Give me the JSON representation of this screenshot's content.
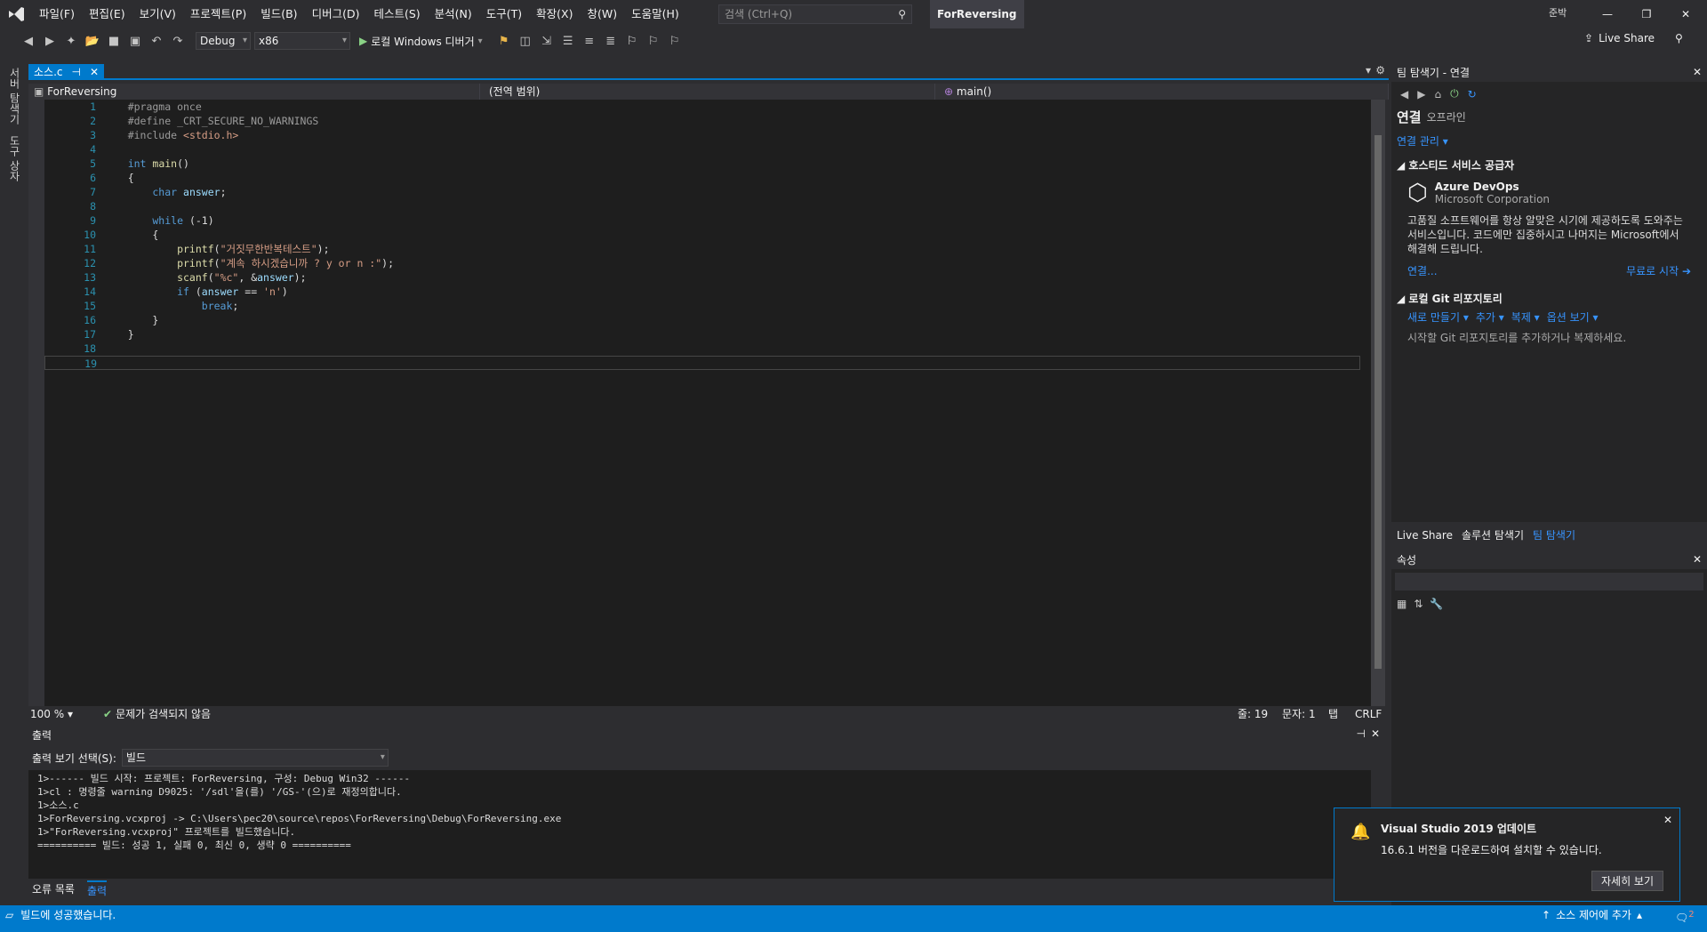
{
  "titlebar": {
    "menu": [
      "파일(F)",
      "편집(E)",
      "보기(V)",
      "프로젝트(P)",
      "빌드(B)",
      "디버그(D)",
      "테스트(S)",
      "분석(N)",
      "도구(T)",
      "확장(X)",
      "창(W)",
      "도움말(H)"
    ],
    "search_placeholder": "검색 (Ctrl+Q)",
    "solution_name": "ForReversing",
    "user_badge": "준박"
  },
  "toolbar": {
    "config": "Debug",
    "platform": "x86",
    "run_label": "로컬 Windows 디버거",
    "live_share": "Live Share"
  },
  "left_sidebar": {
    "items": [
      "서버 탐색기",
      "도구 상자"
    ]
  },
  "editor": {
    "tab_label": "소스.c",
    "nav_project": "ForReversing",
    "nav_scope": "(전역 범위)",
    "nav_function": "main()",
    "lines": [
      {
        "n": "1",
        "segs": [
          [
            "pp",
            "    #pragma once"
          ]
        ]
      },
      {
        "n": "2",
        "segs": [
          [
            "pp",
            "    #define _CRT_SECURE_NO_WARNINGS"
          ]
        ]
      },
      {
        "n": "3",
        "segs": [
          [
            "pp",
            "    #include "
          ],
          [
            "str",
            "<stdio.h>"
          ]
        ]
      },
      {
        "n": "4",
        "segs": []
      },
      {
        "n": "5",
        "segs": [
          [
            "kw",
            "    int"
          ],
          [
            "plain",
            " "
          ],
          [
            "fn",
            "main"
          ],
          [
            "plain",
            "()"
          ]
        ]
      },
      {
        "n": "6",
        "segs": [
          [
            "plain",
            "    {"
          ]
        ]
      },
      {
        "n": "7",
        "segs": [
          [
            "kw",
            "        char"
          ],
          [
            "plain",
            " "
          ],
          [
            "id",
            "answer"
          ],
          [
            "plain",
            ";"
          ]
        ]
      },
      {
        "n": "8",
        "segs": []
      },
      {
        "n": "9",
        "segs": [
          [
            "kw",
            "        while"
          ],
          [
            "plain",
            " (-1)"
          ]
        ]
      },
      {
        "n": "10",
        "segs": [
          [
            "plain",
            "        {"
          ]
        ]
      },
      {
        "n": "11",
        "segs": [
          [
            "fn",
            "            printf"
          ],
          [
            "plain",
            "("
          ],
          [
            "str",
            "\"거짓무한반복테스트\""
          ],
          [
            "plain",
            ");"
          ]
        ]
      },
      {
        "n": "12",
        "segs": [
          [
            "fn",
            "            printf"
          ],
          [
            "plain",
            "("
          ],
          [
            "str",
            "\"계속 하시겠습니까 ? y or n :\""
          ],
          [
            "plain",
            ");"
          ]
        ]
      },
      {
        "n": "13",
        "segs": [
          [
            "fn",
            "            scanf"
          ],
          [
            "plain",
            "("
          ],
          [
            "str",
            "\"%c\""
          ],
          [
            "plain",
            ", &"
          ],
          [
            "id",
            "answer"
          ],
          [
            "plain",
            ");"
          ]
        ]
      },
      {
        "n": "14",
        "segs": [
          [
            "kw",
            "            if"
          ],
          [
            "plain",
            " ("
          ],
          [
            "id",
            "answer"
          ],
          [
            "plain",
            " == "
          ],
          [
            "str",
            "'n'"
          ],
          [
            "plain",
            ")"
          ]
        ]
      },
      {
        "n": "15",
        "segs": [
          [
            "kw",
            "                break"
          ],
          [
            "plain",
            ";"
          ]
        ]
      },
      {
        "n": "16",
        "segs": [
          [
            "plain",
            "        }"
          ]
        ]
      },
      {
        "n": "17",
        "segs": [
          [
            "plain",
            "    }"
          ]
        ]
      },
      {
        "n": "18",
        "segs": []
      },
      {
        "n": "19",
        "segs": []
      }
    ],
    "zoom": "100 %",
    "issues": "문제가 검색되지 않음",
    "line_pos": "줄: 19",
    "col_pos": "문자: 1",
    "tab_mode": "탭",
    "eol": "CRLF"
  },
  "output": {
    "title": "출력",
    "source_label": "출력 보기 선택(S):",
    "source_value": "빌드",
    "lines": [
      "1>------ 빌드 시작: 프로젝트: ForReversing, 구성: Debug Win32 ------",
      "1>cl : 명령줄 warning D9025: '/sdl'을(를) '/GS-'(으)로 재정의합니다.",
      "1>소스.c",
      "1>ForReversing.vcxproj -> C:\\Users\\pec20\\source\\repos\\ForReversing\\Debug\\ForReversing.exe",
      "1>\"ForReversing.vcxproj\" 프로젝트를 빌드했습니다.",
      "========== 빌드: 성공 1, 실패 0, 최신 0, 생략 0 =========="
    ],
    "tabs": [
      "오류 목록",
      "출력"
    ]
  },
  "team_explorer": {
    "title": "팀 탐색기 - 연결",
    "heading": "연결",
    "status": "오프라인",
    "manage": "연결 관리",
    "hosted_section": "호스티드 서비스 공급자",
    "azure_name": "Azure DevOps",
    "azure_company": "Microsoft Corporation",
    "azure_desc": "고품질 소프트웨어를 항상 알맞은 시기에 제공하도록 도와주는 서비스입니다. 코드에만 집중하시고 나머지는 Microsoft에서 해결해 드립니다.",
    "connect": "연결...",
    "free_start": "무료로 시작",
    "local_git": "로컬 Git 리포지토리",
    "git_actions": [
      "새로 만들기",
      "추가",
      "복제",
      "옵션 보기"
    ],
    "git_hint": "시작할 Git 리포지토리를 추가하거나 복제하세요.",
    "tabs": [
      "Live Share",
      "솔루션 탐색기",
      "팀 탐색기"
    ]
  },
  "properties": {
    "title": "속성"
  },
  "toast": {
    "title": "Visual Studio 2019 업데이트",
    "body": "16.6.1 버전을 다운로드하여 설치할 수 있습니다.",
    "button": "자세히 보기"
  },
  "statusbar": {
    "message": "빌드에 성공했습니다.",
    "source_control": "소스 제어에 추가",
    "notif_count": "2"
  },
  "colors": {
    "accent": "#007acc",
    "background": "#2d2d30",
    "editor_bg": "#1e1e1e"
  }
}
